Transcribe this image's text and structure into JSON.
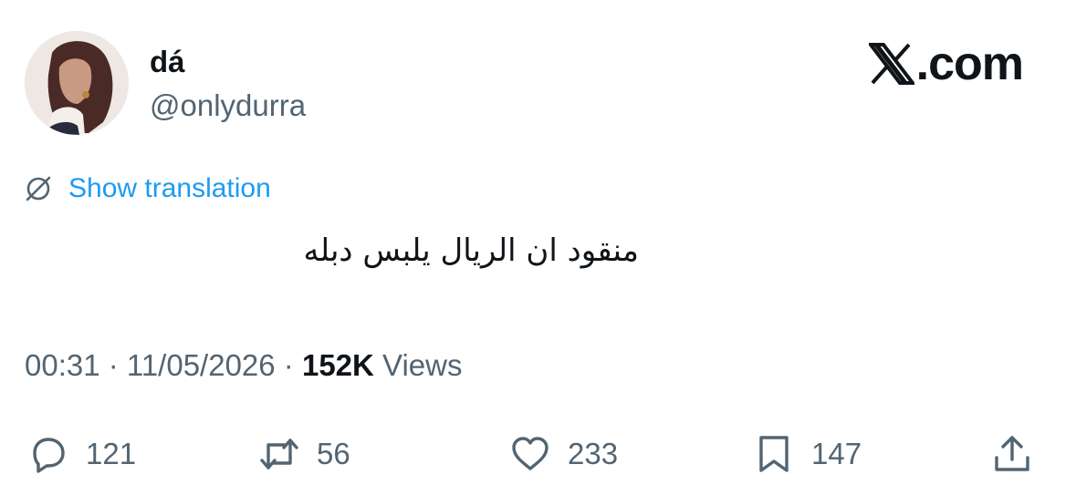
{
  "user": {
    "display_name": "dá",
    "handle": "@onlydurra"
  },
  "brand": {
    "text": ".com"
  },
  "translation": {
    "label": "Show translation"
  },
  "tweet": {
    "text": "منقود ان الريال يلبس دبله"
  },
  "meta": {
    "time": "00:31",
    "separator": " · ",
    "date": "11/05/2026",
    "views_count": "152K",
    "views_label": "Views"
  },
  "actions": {
    "replies": "121",
    "reposts": "56",
    "likes": "233",
    "bookmarks": "147"
  },
  "colors": {
    "text": "#0f1419",
    "secondary": "#536471",
    "link": "#1d9bf0"
  },
  "icons": [
    "globe-off-icon",
    "x-logo-icon",
    "reply-icon",
    "retweet-icon",
    "like-icon",
    "bookmark-icon",
    "share-icon"
  ]
}
